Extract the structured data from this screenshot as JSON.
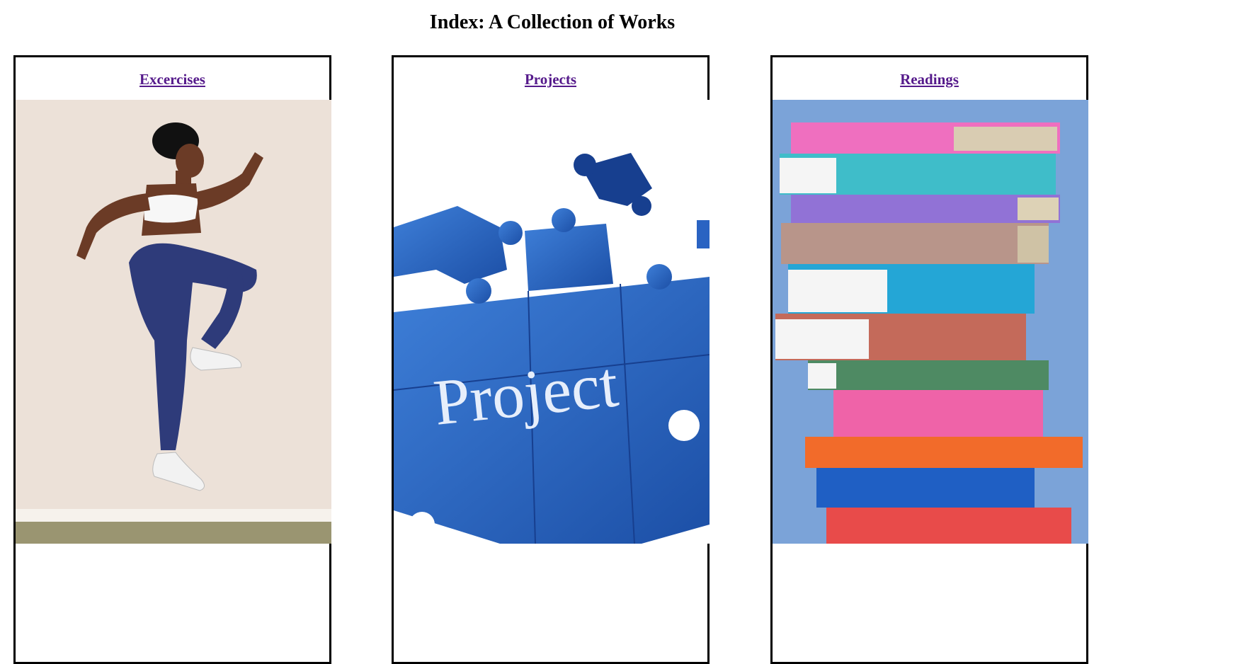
{
  "page": {
    "title": "Index: A Collection of Works"
  },
  "cards": [
    {
      "label": "Excercises",
      "image_subject": "athlete-jumping-image"
    },
    {
      "label": "Projects",
      "image_subject": "puzzle-project-image",
      "image_text": "Project"
    },
    {
      "label": "Readings",
      "image_subject": "book-stack-image"
    }
  ],
  "colors": {
    "link": "#551a8b",
    "border": "#000000"
  }
}
